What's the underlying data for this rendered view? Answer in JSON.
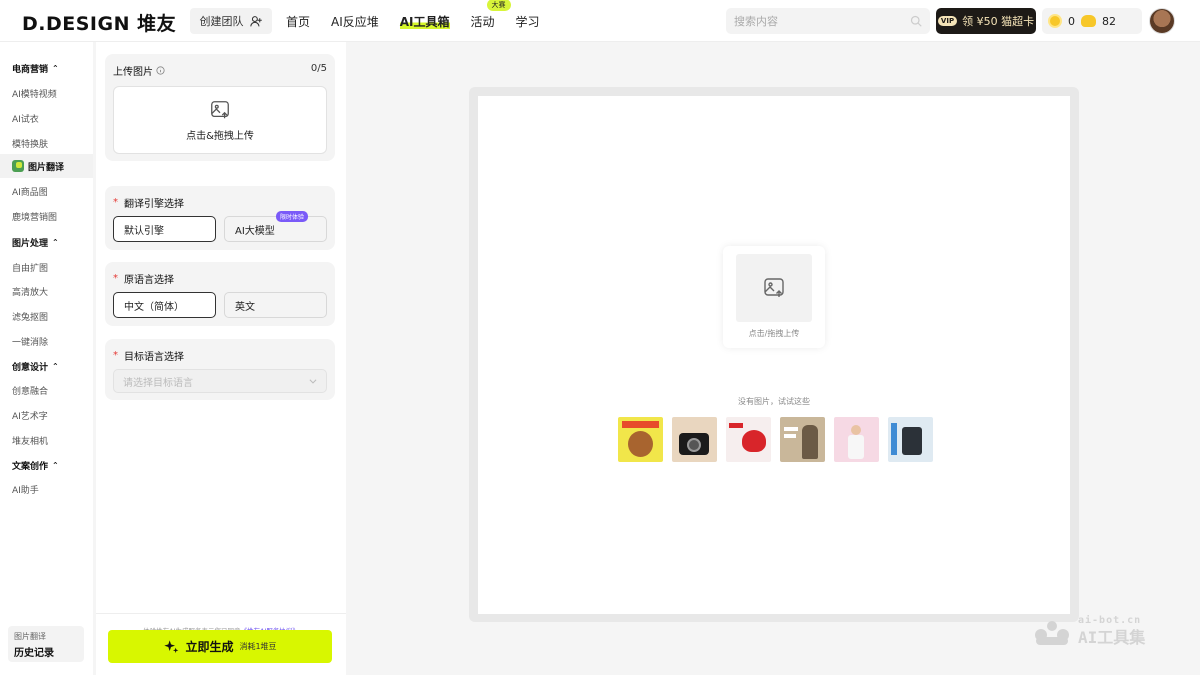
{
  "header": {
    "logo": "D.DESIGN 堆友",
    "team_button": "创建团队",
    "nav": [
      {
        "label": "首页"
      },
      {
        "label": "AI反应堆"
      },
      {
        "label": "AI工具箱"
      },
      {
        "label": "活动",
        "badge": "大赛"
      },
      {
        "label": "学习"
      }
    ],
    "search_placeholder": "搜索内容",
    "vip_tag": "VIP",
    "vip_label": "领 ¥50 猫超卡",
    "coins": "0",
    "beans": "82"
  },
  "sidebar": {
    "groups": [
      {
        "label": "电商营销",
        "items": [
          "AI模特视频",
          "AI试衣",
          "模特换肤",
          "图片翻译",
          "AI商品图",
          "鹿境营销图"
        ]
      },
      {
        "label": "图片处理",
        "items": [
          "自由扩图",
          "高清放大",
          "滤兔抠图",
          "一键消除"
        ]
      },
      {
        "label": "创意设计",
        "items": [
          "创意融合",
          "AI艺术字",
          "堆友相机"
        ]
      },
      {
        "label": "文案创作",
        "items": [
          "AI助手"
        ]
      }
    ],
    "active": "图片翻译",
    "history_sub": "图片翻译",
    "history_title": "历史记录"
  },
  "panel": {
    "upload_title": "上传图片",
    "upload_count": "0/5",
    "upload_text": "点击&拖拽上传",
    "engine_title": "翻译引擎选择",
    "engine_default": "默认引擎",
    "engine_ai": "AI大模型",
    "engine_ai_tag": "限时体验",
    "source_title": "原语言选择",
    "source_zh": "中文（简体）",
    "source_en": "英文",
    "target_title": "目标语言选择",
    "target_placeholder": "请选择目标语言",
    "agree_text": "体验堆友AI生成服务表示您已同意",
    "agree_link": "《堆友AI服务协议》",
    "generate_label": "立即生成",
    "generate_sub": "消耗1堆豆"
  },
  "canvas": {
    "drop_text": "点击/拖拽上传",
    "try_text": "没有图片，试试这些",
    "samples": [
      {
        "name": "sample-teddy-bear",
        "bg": "#f1e64a"
      },
      {
        "name": "sample-camera",
        "bg": "#e9d6bf"
      },
      {
        "name": "sample-helmet",
        "bg": "#f6eeee"
      },
      {
        "name": "sample-spring-sale",
        "bg": "#c9b79a"
      },
      {
        "name": "sample-fashion",
        "bg": "#f6d9e4"
      },
      {
        "name": "sample-sale",
        "bg": "#dfeaf2"
      }
    ]
  },
  "watermark": {
    "line1": "ai-bot.cn",
    "line2": "AI工具集"
  }
}
